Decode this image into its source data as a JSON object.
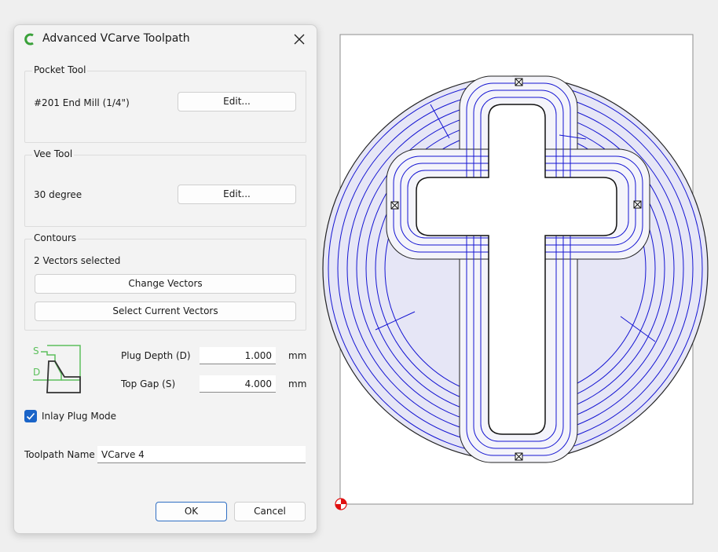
{
  "dialog": {
    "title": "Advanced VCarve Toolpath",
    "logo_icon": "vcarve-logo-icon",
    "close_icon": "close-icon"
  },
  "pocket_tool": {
    "title": "Pocket Tool",
    "tool_name": "#201 End Mill (1/4\")",
    "edit_label": "Edit..."
  },
  "vee_tool": {
    "title": "Vee Tool",
    "tool_name": "30 degree",
    "edit_label": "Edit..."
  },
  "contours": {
    "title": "Contours",
    "status": "2 Vectors selected",
    "change_label": "Change Vectors",
    "select_label": "Select Current Vectors"
  },
  "plug": {
    "diagram_s": "S",
    "diagram_d": "D",
    "depth_label": "Plug Depth (D)",
    "depth_value": "1.000",
    "depth_unit": "mm",
    "gap_label": "Top Gap (S)",
    "gap_value": "4.000",
    "gap_unit": "mm"
  },
  "inlay": {
    "label": "Inlay Plug Mode",
    "checked": true
  },
  "toolpath": {
    "label": "Toolpath Name",
    "value": "VCarve 4"
  },
  "buttons": {
    "ok": "OK",
    "cancel": "Cancel"
  },
  "colors": {
    "toolpath_blue": "#1414d2",
    "accent": "#1a64c8",
    "diagram_green": "#5cc05c",
    "origin_red": "#e01010"
  }
}
